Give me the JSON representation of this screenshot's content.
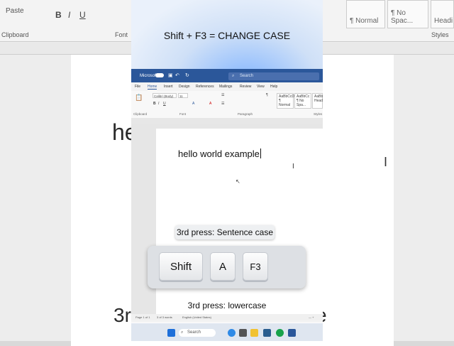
{
  "background": {
    "clipboard_label": "Clipboard",
    "paste_label": "Paste",
    "font_group_label": "Font",
    "styles_group_label": "Styles",
    "style_normal": "¶ Normal",
    "style_nospacing": "¶ No Spac...",
    "style_heading": "Headi",
    "large_text": "hel",
    "bottom_text_left": "3rd",
    "bottom_text_right": "e"
  },
  "video": {
    "title": "Shift + F3 = CHANGE CASE"
  },
  "word": {
    "app_name": "Microsoft",
    "search_placeholder": "Search",
    "tabs": [
      "File",
      "Home",
      "Insert",
      "Design",
      "References",
      "Mailings",
      "Review",
      "View",
      "Help"
    ],
    "active_tab": "Home",
    "font_name": "Calibri (Body)",
    "font_size": "11",
    "groups": {
      "clipboard": "Clipboard",
      "font": "Font",
      "paragraph": "Paragraph",
      "styles": "Styles"
    },
    "styles": [
      {
        "preview": "AaBbCcDc",
        "name": "¶ Normal"
      },
      {
        "preview": "AaBbCc",
        "name": "¶ No Spa..."
      },
      {
        "preview": "AaBbC",
        "name": "Headi"
      }
    ],
    "document_text": "hello world example",
    "status": {
      "page": "Page 1 of 1",
      "words": "3 of 3 words",
      "language": "English (United States)"
    }
  },
  "overlay": {
    "tooltip": "3rd press: Sentence case",
    "keys": [
      "Shift",
      "A",
      "F3"
    ],
    "caption": "3rd press: lowercase"
  },
  "taskbar": {
    "search_label": "Search"
  },
  "colors": {
    "word_blue": "#2b579a",
    "accent": "#7fb3ff"
  }
}
